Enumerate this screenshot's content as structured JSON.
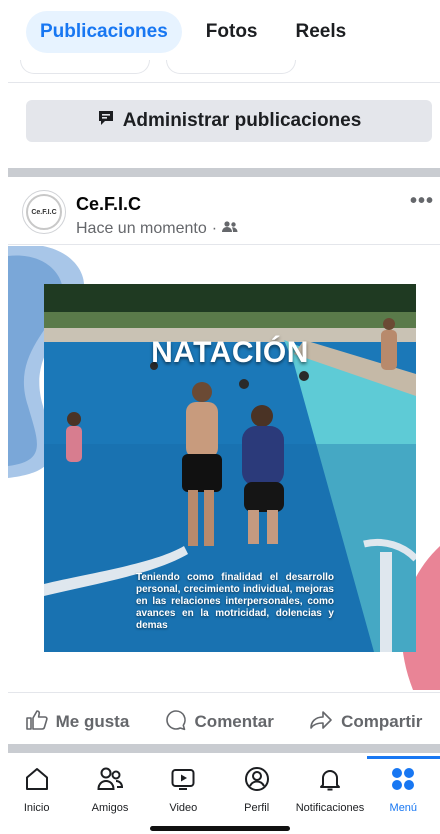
{
  "tabs": [
    {
      "label": "Publicaciones",
      "active": true
    },
    {
      "label": "Fotos",
      "active": false
    },
    {
      "label": "Reels",
      "active": false
    }
  ],
  "manage_button": {
    "label": "Administrar publicaciones",
    "icon": "edit-message-icon"
  },
  "post": {
    "author": "Ce.F.I.C",
    "avatar_text": "Ce.F.I.C",
    "time": "Hace un momento",
    "separator": "·",
    "audience_icon": "friends-icon",
    "more_label": "•••",
    "image": {
      "title": "NATACIÓN",
      "caption": "Teniendo como finalidad el desarrollo personal, crecimiento individual, mejoras en las relaciones interpersonales, como avances en la motricidad, dolencias y demas"
    },
    "actions": [
      {
        "label": "Me gusta",
        "icon": "thumbs-up-icon"
      },
      {
        "label": "Comentar",
        "icon": "comment-icon"
      },
      {
        "label": "Compartir",
        "icon": "share-icon"
      }
    ]
  },
  "nav": [
    {
      "label": "Inicio",
      "icon": "home-icon",
      "active": false
    },
    {
      "label": "Amigos",
      "icon": "friends-icon",
      "active": false
    },
    {
      "label": "Video",
      "icon": "video-icon",
      "active": false
    },
    {
      "label": "Perfil",
      "icon": "profile-icon",
      "active": false
    },
    {
      "label": "Notificaciones",
      "icon": "bell-icon",
      "active": false
    },
    {
      "label": "Menú",
      "icon": "menu-grid-icon",
      "active": true
    }
  ],
  "colors": {
    "accent": "#1877f2",
    "secondary_text": "#65676b",
    "divider": "#c9ccd1",
    "pool": "#1d6aa5"
  }
}
